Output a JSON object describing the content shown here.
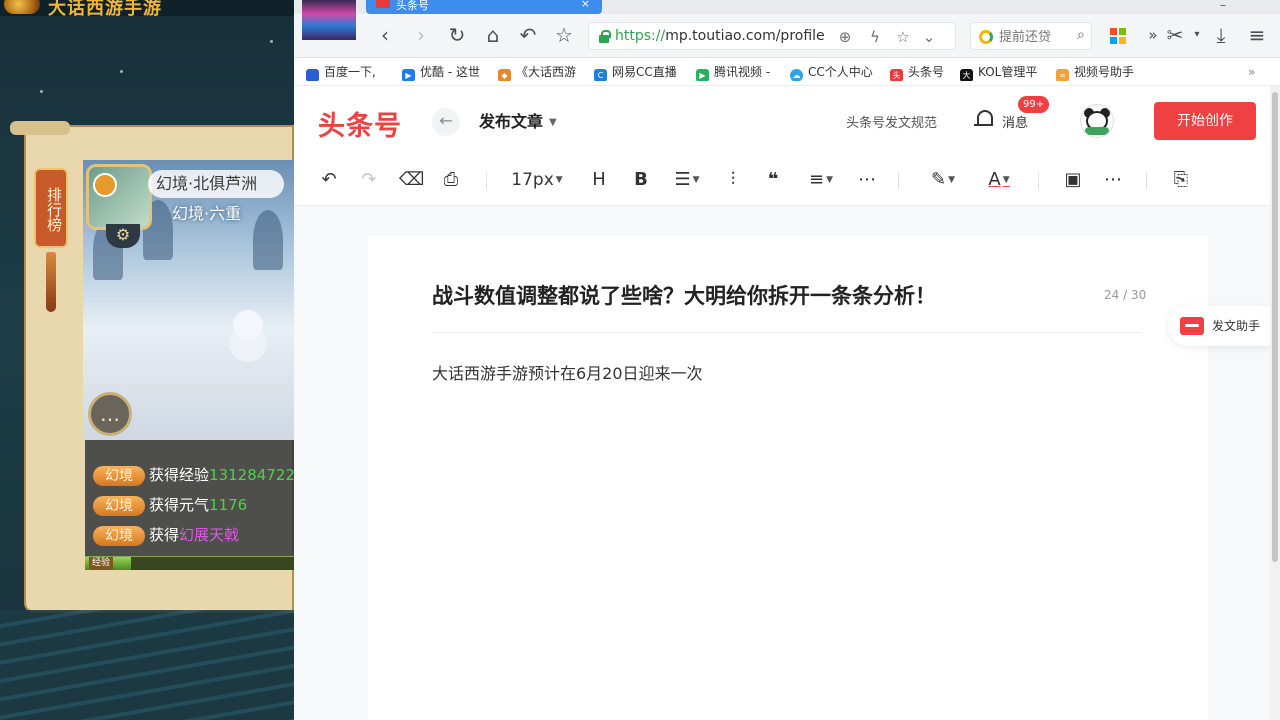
{
  "game": {
    "title": "大话西游手游",
    "rank_tab": "排行榜",
    "region": "幻境·北俱芦洲",
    "region_sub": "幻境·六重",
    "log": [
      {
        "tag": "幻境",
        "label": "获得经验",
        "value": "131284722",
        "value_color": "green"
      },
      {
        "tag": "幻境",
        "label": "获得元气",
        "value": "1176",
        "value_color": "green"
      },
      {
        "tag": "幻境",
        "label": "获得",
        "value": "幻展天戟",
        "value_color": "purple"
      }
    ],
    "exp_progress": 0.22,
    "level_label": "经验"
  },
  "browser": {
    "tab_title": "头条号",
    "url_scheme": "https://",
    "url_rest": "mp.toutiao.com/profile",
    "search_placeholder": "提前还贷",
    "bookmarks": [
      "百度一下,",
      "优酷 - 这世",
      "《大话西游",
      "网易CC直播",
      "腾讯视频 -",
      "CC个人中心",
      "头条号",
      "KOL管理平",
      "视频号助手"
    ],
    "colors": {
      "accent": "#3c8df0",
      "secure": "#2da44e"
    }
  },
  "header": {
    "brand": "头条号",
    "publish_title": "发布文章",
    "rules_link": "头条号发文规范",
    "messages_label": "消息",
    "messages_badge": "99+",
    "create_button": "开始创作",
    "brand_color": "#f04142"
  },
  "editor_toolbar": {
    "font_size": "17px",
    "heading": "H",
    "bold": "B"
  },
  "document": {
    "title": "战斗数值调整都说了些啥？大明给你拆开一条条分析！",
    "char_count": "24 / 30",
    "body": "大话西游手游预计在6月20日迎来一次"
  },
  "assistant": {
    "label": "发文助手"
  }
}
